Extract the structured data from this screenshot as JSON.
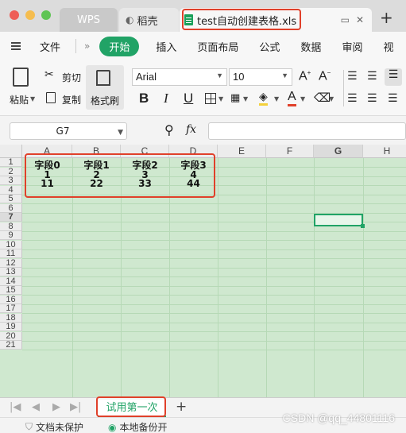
{
  "window": {
    "tabs": [
      {
        "label": "WPS"
      },
      {
        "label": "稻壳"
      },
      {
        "label": "test自动创建表格.xls"
      }
    ]
  },
  "menu": {
    "file_label": "文件",
    "items": [
      "开始",
      "插入",
      "页面布局",
      "公式",
      "数据",
      "审阅",
      "视"
    ]
  },
  "ribbon": {
    "paste_label": "粘贴",
    "cut_label": "剪切",
    "copy_label": "复制",
    "format_painter_label": "格式刷",
    "font_name": "Arial",
    "font_size": "10",
    "bold": "B",
    "italic": "I",
    "underline": "U",
    "font_color_letter": "A"
  },
  "formula_bar": {
    "name_box": "G7",
    "fx": "fx",
    "value": ""
  },
  "grid": {
    "columns": [
      "A",
      "B",
      "C",
      "D",
      "E",
      "F",
      "G",
      "H"
    ],
    "rows": [
      "1",
      "2",
      "3",
      "4",
      "5",
      "6",
      "7",
      "8",
      "9",
      "10",
      "11",
      "12",
      "13",
      "14",
      "15",
      "16",
      "17",
      "18",
      "19",
      "20",
      "21"
    ],
    "cells": [
      [
        "字段0",
        "字段1",
        "字段2",
        "字段3"
      ],
      [
        "1",
        "2",
        "3",
        "4"
      ],
      [
        "11",
        "22",
        "33",
        "44"
      ]
    ],
    "selected_cell": "G7"
  },
  "sheets": {
    "tabs": [
      "试用第一次"
    ],
    "add_label": "+"
  },
  "status": {
    "protect_label": "文档未保护",
    "backup_label": "本地备份开"
  },
  "watermark": "CSDN @qq_44801116",
  "colors": {
    "accent": "#21a366",
    "grid_bg": "#cfe8cf",
    "highlight": "#e0402a"
  }
}
